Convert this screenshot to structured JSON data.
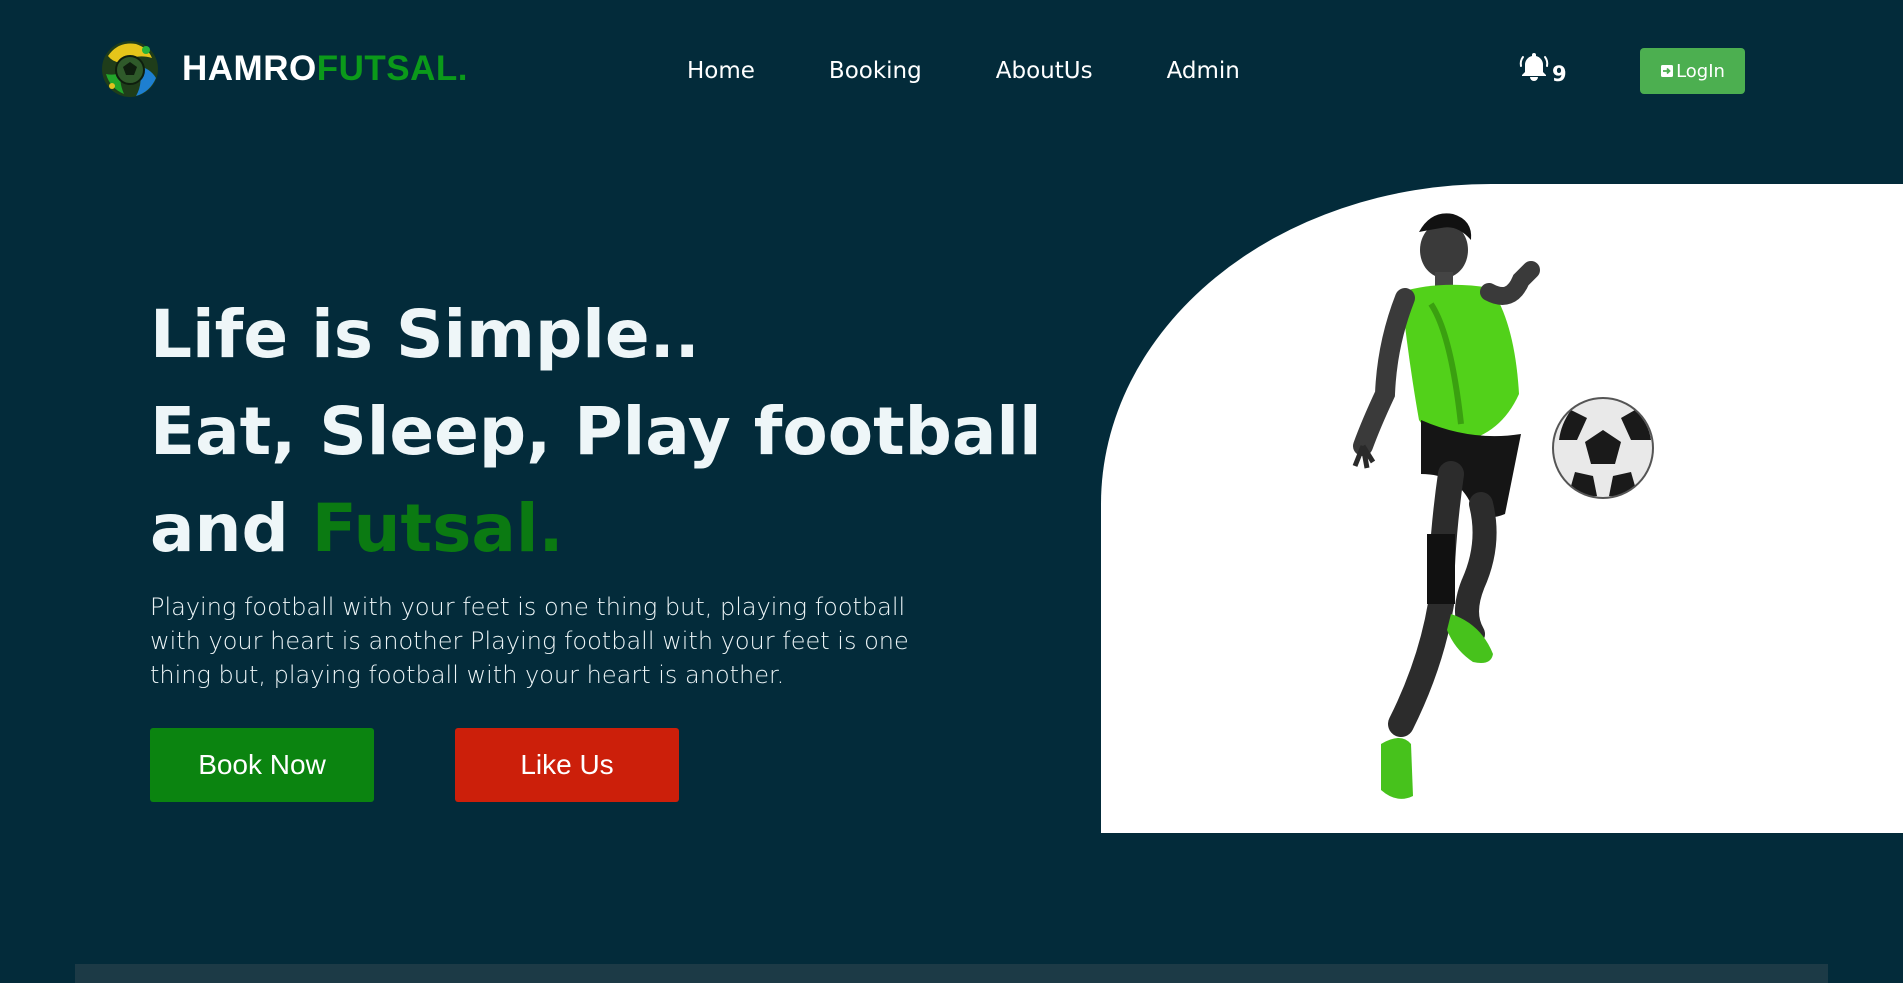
{
  "header": {
    "brand_part1": "HAMRO",
    "brand_part2": "FUTSAL.",
    "logo_icon": "soccer-ball-logo-icon",
    "nav": [
      {
        "label": "Home"
      },
      {
        "label": "Booking"
      },
      {
        "label": "AboutUs"
      },
      {
        "label": "Admin"
      }
    ],
    "notification_icon": "bell-icon",
    "notification_count": "9",
    "login_label": "LogIn",
    "login_icon": "login-icon"
  },
  "hero": {
    "title_line1": "Life is Simple..",
    "title_line2": "Eat, Sleep, Play football",
    "title_line3_prefix": "and ",
    "title_line3_highlight": "Futsal.",
    "description": "Playing football with your feet is one thing but, playing football with your heart is another Playing football with your feet is one thing but, playing football with your heart is another.",
    "book_button": "Book Now",
    "like_button": "Like Us"
  },
  "colors": {
    "background": "#032b3a",
    "brand_accent": "#0b9a1a",
    "book_button": "#0b8410",
    "like_button": "#cc1f0a",
    "login_button": "#4caf50"
  }
}
